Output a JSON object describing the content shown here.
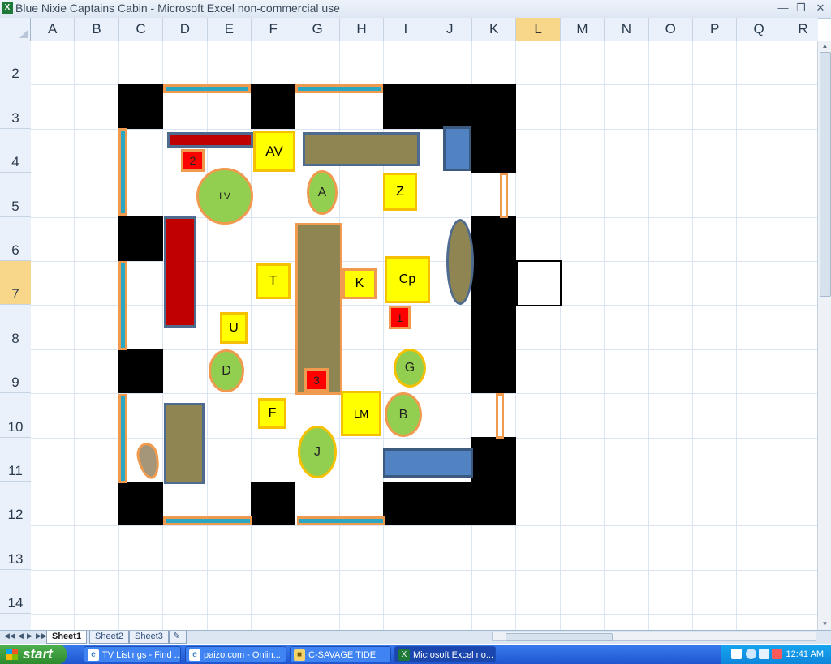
{
  "window": {
    "title": "Blue Nixie Captains Cabin - Microsoft Excel non-commercial use",
    "app_icon": "X",
    "controls": [
      "minimize-icon",
      "restore-icon",
      "close-icon"
    ]
  },
  "grid": {
    "columns": [
      "A",
      "B",
      "C",
      "D",
      "E",
      "F",
      "G",
      "H",
      "I",
      "J",
      "K",
      "L",
      "M",
      "N",
      "O",
      "P",
      "Q",
      "R"
    ],
    "rows": [
      "2",
      "3",
      "4",
      "5",
      "6",
      "7",
      "8",
      "9",
      "10",
      "11",
      "12",
      "13",
      "14"
    ],
    "selected_column": "L",
    "selected_row": "7",
    "selected_cell": "L7"
  },
  "map": {
    "labels": {
      "av": "AV",
      "z": "Z",
      "a": "A",
      "lv": "LV",
      "t": "T",
      "k": "K",
      "cp": "Cp",
      "u": "U",
      "d": "D",
      "g": "G",
      "f": "F",
      "lm": "LM",
      "b": "B",
      "j": "J",
      "n1": "1",
      "n2": "2",
      "n3": "3"
    },
    "colors": {
      "wall": "#000000",
      "window": "#2aa7c2",
      "trim": "#ef9a4f",
      "table": "#8f8552",
      "bunk": "#c00000",
      "chest": "#5183c3",
      "token_square": "#ffff00",
      "token_round": "#92cf50",
      "marker": "#ff0000"
    }
  },
  "sheets": [
    "Sheet1",
    "Sheet2",
    "Sheet3"
  ],
  "active_sheet": "Sheet1",
  "taskbar": {
    "start_label": "start",
    "items": [
      {
        "label": "TV Listings - Find ...",
        "icon": "ie-icon"
      },
      {
        "label": "paizo.com - Onlin...",
        "icon": "ie-icon"
      },
      {
        "label": "C-SAVAGE TIDE",
        "icon": "folder-icon"
      },
      {
        "label": "Microsoft Excel no...",
        "icon": "excel-icon"
      }
    ],
    "clock": "12:41 AM"
  }
}
